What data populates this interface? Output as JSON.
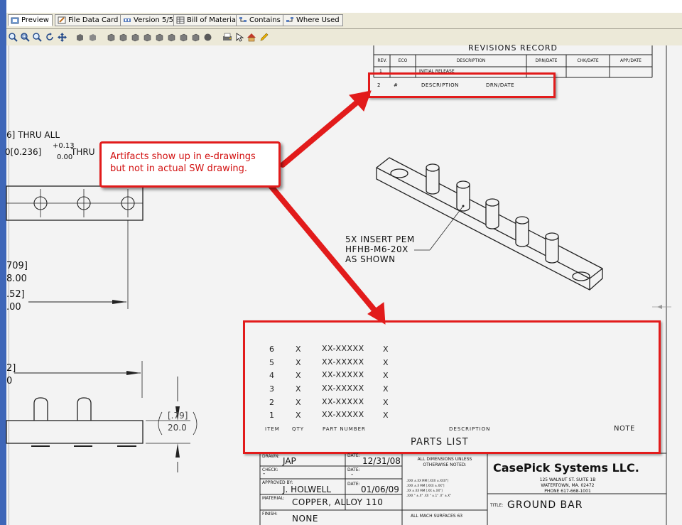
{
  "tabs": [
    {
      "label": "Preview",
      "icon": "preview-icon"
    },
    {
      "label": "File Data Card",
      "icon": "data-card-icon"
    },
    {
      "label": "Version 5/5",
      "icon": "version-icon"
    },
    {
      "label": "Bill of Materials",
      "icon": "bom-icon"
    },
    {
      "label": "Contains",
      "icon": "contains-icon"
    },
    {
      "label": "Where Used",
      "icon": "where-used-icon"
    }
  ],
  "toolbar": {
    "icons": [
      "zoom-icon",
      "zoom-window-icon",
      "zoom-fit-icon",
      "rotate-icon",
      "pan-icon",
      "shaded-icon",
      "wireframe-icon",
      "view-front-icon",
      "view-back-icon",
      "view-left-icon",
      "view-right-icon",
      "view-top-icon",
      "view-iso-icon",
      "sphere-icon",
      "print-icon",
      "select-icon",
      "home-icon",
      "markup-pen-icon"
    ]
  },
  "drawing": {
    "left_dims": {
      "thru_all": "6]  THRU ALL",
      "diam": "0[0.236]",
      "tol_plus": "+0.13",
      "tol_zero": "0.00",
      "thru": "THRU",
      "d709": "709]",
      "d800": "8.00",
      "d52": ".52]",
      "d00a": ".00",
      "d2": "2]",
      "d0": "0",
      "d79": "[.79]",
      "d200": "20.0"
    },
    "note": [
      "5X INSERT PEM",
      "HFHB-M6-20X",
      "AS SHOWN"
    ],
    "revisions": {
      "title": "REVISIONS RECORD",
      "headers": [
        "REV.",
        "ECO",
        "DESCRIPTION",
        "DRN/DATE",
        "CHK/DATE",
        "APP./DATE"
      ],
      "row1": [
        "1",
        "",
        "INITIAL RELEASE",
        "",
        "",
        ""
      ],
      "row2": [
        "2",
        "#",
        "DESCRIPTION",
        "DRN/DATE",
        "",
        ""
      ]
    },
    "parts_list": {
      "rows": [
        [
          "6",
          "X",
          "XX-XXXXX",
          "X"
        ],
        [
          "5",
          "X",
          "XX-XXXXX",
          "X"
        ],
        [
          "4",
          "X",
          "XX-XXXXX",
          "X"
        ],
        [
          "3",
          "X",
          "XX-XXXXX",
          "X"
        ],
        [
          "2",
          "X",
          "XX-XXXXX",
          "X"
        ],
        [
          "1",
          "X",
          "XX-XXXXX",
          "X"
        ]
      ],
      "headers": {
        "item": "ITEM",
        "qty": "QTY",
        "part": "PART NUMBER",
        "desc": "DESCRIPTION",
        "note": "NOTE"
      },
      "title": "PARTS LIST"
    },
    "title_block": {
      "drawn_label": "DRAWN:",
      "drawn": "JAP",
      "date_label": "DATE:",
      "date1": "12/31/08",
      "check_label": "CHECK:",
      "check": "-",
      "date2_label": "DATE:",
      "date2": "-",
      "approved_label": "APPROVED BY:",
      "approved": "J. HOLWELL",
      "date3_label": "DATE:",
      "date3": "01/06/09",
      "material_label": "MATERIAL:",
      "material": "COPPER, ALLOY 110",
      "finish_label": "FINISH:",
      "finish": "NONE",
      "dims_note1": "ALL DIMENSIONS UNLESS",
      "dims_note2": "OTHERWISE NOTED:",
      "tol1": ".XXX ±.XX MM [.XXX ±.XXX\"]",
      "tol2": ".XXX ±.X MM [.XXX ±.XX\"]",
      "tol3": ".XX ±.XX MM [.XX ±.XX\"]",
      "tol4": ".XXX ° ±.X° .XX ° ±.1° .X° ±.X°",
      "surf": "ALL MACH SURFACES 63",
      "company": "CasePick Systems LLC.",
      "addr1": "125 WALNUT ST. SUITE 1B",
      "addr2": "WATERTOWN, MA. 02472",
      "phone": "PHONE 617-668-1001",
      "title_label": "TITLE:",
      "title": "GROUND BAR"
    }
  },
  "callout": {
    "line1": "Artifacts show up in e-drawings",
    "line2": "but not in actual SW drawing."
  },
  "colors": {
    "accent_red": "#e21b1b",
    "toolbar_bg": "#ece9d8",
    "canvas_bg": "#f3f3f3",
    "left_bar": "#3e66b8"
  }
}
